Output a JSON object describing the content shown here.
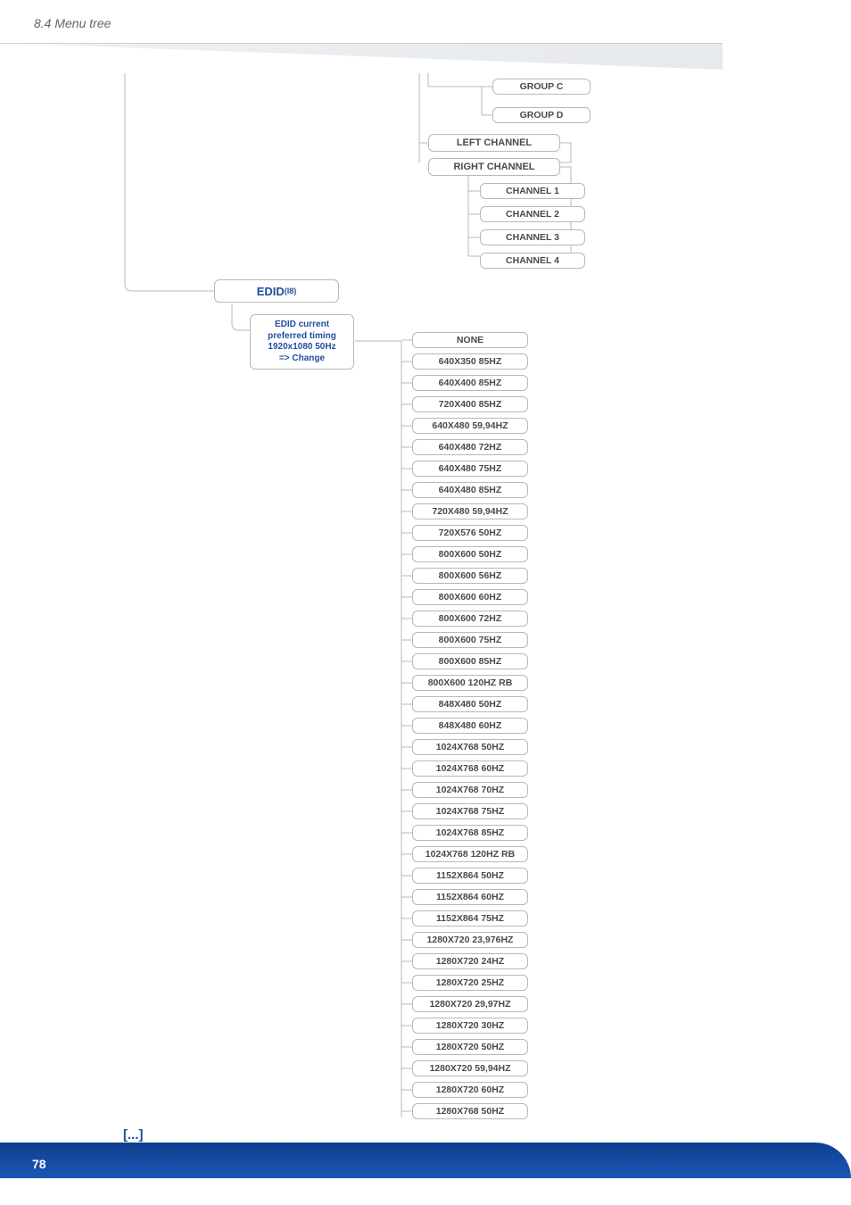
{
  "header": {
    "title": "8.4 Menu tree"
  },
  "footer": {
    "continued": "[...]",
    "page": "78"
  },
  "edid_main": {
    "label": "EDID",
    "sup": "(I8)"
  },
  "edid_box": {
    "l1": "EDID current",
    "l2": "preferred timing",
    "l3": "1920x1080 50Hz",
    "l4": "=> Change"
  },
  "top_tree": {
    "group_c": "GROUP C",
    "group_d": "GROUP D",
    "left_channel": "LEFT CHANNEL",
    "right_channel": "RIGHT CHANNEL",
    "channels": [
      "CHANNEL 1",
      "CHANNEL 2",
      "CHANNEL 3",
      "CHANNEL 4"
    ]
  },
  "timings": [
    "NONE",
    "640X350 85HZ",
    "640X400 85HZ",
    "720X400 85HZ",
    "640X480 59,94HZ",
    "640X480 72HZ",
    "640X480 75HZ",
    "640X480 85HZ",
    "720X480 59,94HZ",
    "720X576 50HZ",
    "800X600 50HZ",
    "800X600 56HZ",
    "800X600 60HZ",
    "800X600 72HZ",
    "800X600 75HZ",
    "800X600 85HZ",
    "800X600 120HZ RB",
    "848X480 50HZ",
    "848X480 60HZ",
    "1024X768 50HZ",
    "1024X768 60HZ",
    "1024X768 70HZ",
    "1024X768 75HZ",
    "1024X768 85HZ",
    "1024X768 120HZ RB",
    "1152X864 50HZ",
    "1152X864 60HZ",
    "1152X864 75HZ",
    "1280X720 23,976HZ",
    "1280X720 24HZ",
    "1280X720 25HZ",
    "1280X720 29,97HZ",
    "1280X720 30HZ",
    "1280X720 50HZ",
    "1280X720 59,94HZ",
    "1280X720 60HZ",
    "1280X768 50HZ"
  ]
}
